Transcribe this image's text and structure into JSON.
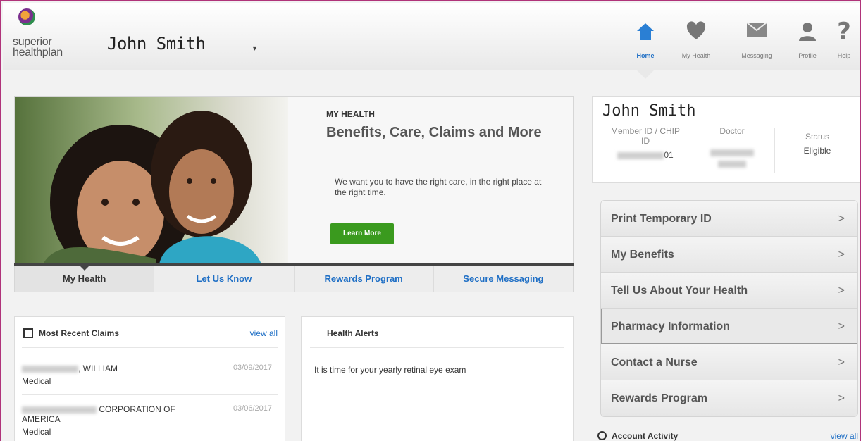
{
  "header": {
    "logo_line1": "superior",
    "logo_line2": "healthplan",
    "user_name": "John Smith",
    "caret": "▾"
  },
  "nav": [
    {
      "label": "Home",
      "icon": "home-icon",
      "active": true
    },
    {
      "label": "My Health",
      "icon": "heart-icon"
    },
    {
      "label": "Messaging",
      "icon": "envelope-icon"
    },
    {
      "label": "Profile",
      "icon": "person-icon"
    },
    {
      "label": "Help",
      "icon": "question-icon"
    }
  ],
  "hero": {
    "small_title": "MY HEALTH",
    "title": "Benefits, Care, Claims and More",
    "text": "We want you to have the right care, in the right place at the right time.",
    "button": "Learn More"
  },
  "tabs": [
    "My Health",
    "Let Us Know",
    "Rewards Program",
    "Secure Messaging"
  ],
  "claims": {
    "title": "Most Recent Claims",
    "view_all": "view all",
    "rows": [
      {
        "name": ", WILLIAM",
        "type": "Medical",
        "date": "03/09/2017"
      },
      {
        "name": "CORPORATION OF AMERICA",
        "type": "Medical",
        "date": "03/06/2017"
      }
    ]
  },
  "alerts": {
    "title": "Health Alerts",
    "text": "It is time for your yearly retinal eye exam"
  },
  "profile": {
    "name": "John Smith",
    "member_label": "Member ID / CHIP ID",
    "member_value": "01",
    "doctor_label": "Doctor",
    "status_label": "Status",
    "status_value": "Eligible"
  },
  "menu": [
    "Print Temporary ID",
    "My Benefits",
    "Tell Us About Your Health",
    "Pharmacy Information",
    "Contact a Nurse",
    "Rewards Program"
  ],
  "menu_chevron": ">",
  "activity": {
    "title": "Account Activity",
    "view_all": "view all"
  },
  "colors": {
    "accent_blue": "#1f6fc5",
    "button_green": "#3a9a1e",
    "frame_magenta": "#b0337a"
  }
}
